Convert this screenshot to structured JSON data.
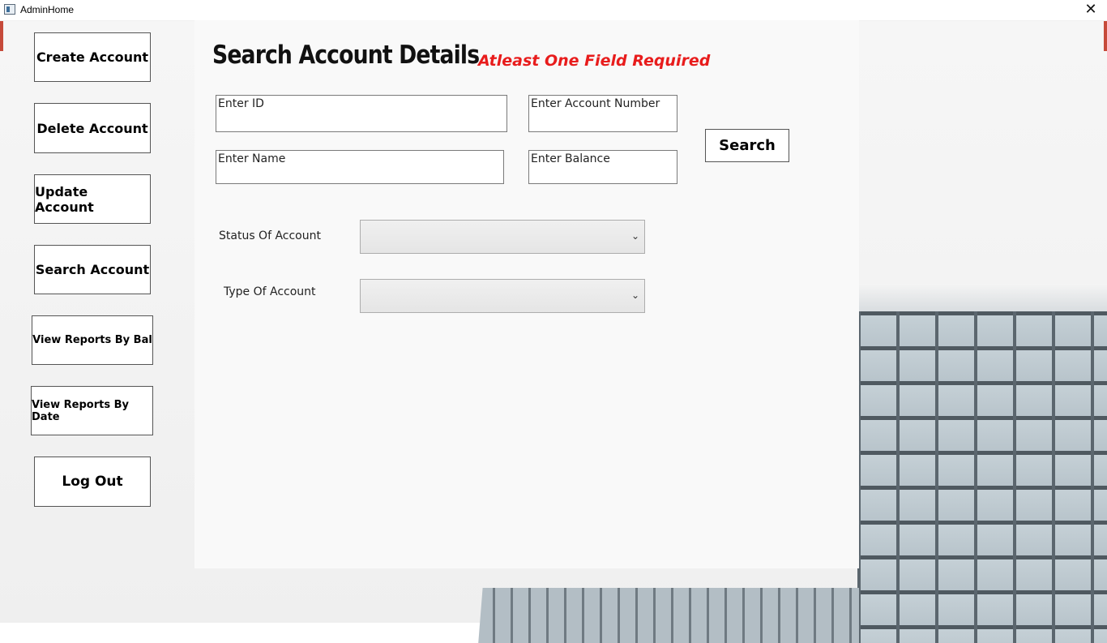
{
  "window": {
    "title": "AdminHome",
    "close_glyph": "✕"
  },
  "nav": {
    "create": "Create Account",
    "delete": "Delete Account",
    "update": "Update Account",
    "search": "Search Account",
    "reports_bal": "View Reports By Bal",
    "reports_date": "View Reports By Date",
    "logout": "Log Out"
  },
  "main": {
    "heading": "Search Account Details",
    "warning": "Atleast One Field Required",
    "fields": {
      "id": "Enter ID",
      "account_number": "Enter Account Number",
      "name": "Enter Name",
      "balance": "Enter Balance"
    },
    "search_button": "Search",
    "status_label": "Status Of Account",
    "type_label": "Type Of Account",
    "status_value": "",
    "type_value": "",
    "chevron": "⌄"
  },
  "colors": {
    "warning": "#e81c1c",
    "panel": "#f9f9f9"
  }
}
